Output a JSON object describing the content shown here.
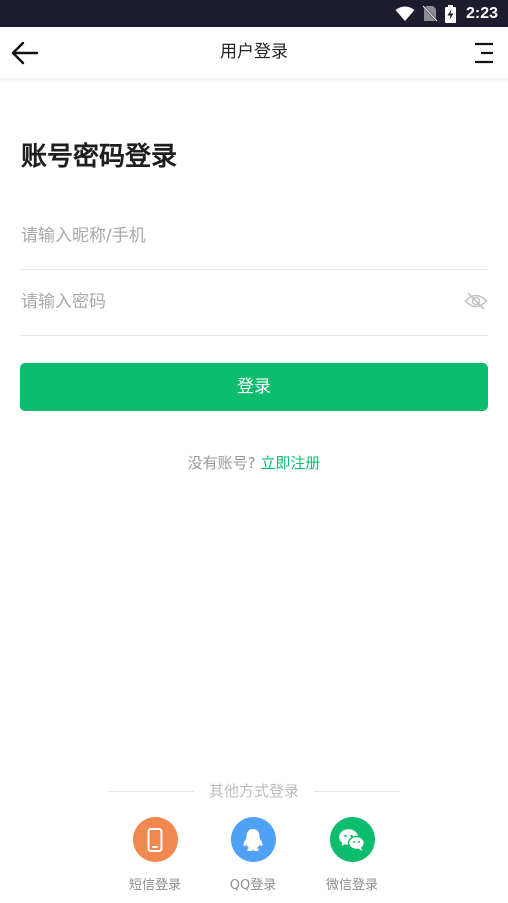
{
  "status_bar": {
    "time": "2:23"
  },
  "header": {
    "title": "用户登录"
  },
  "login": {
    "title": "账号密码登录",
    "username_placeholder": "请输入昵称/手机",
    "password_placeholder": "请输入密码",
    "submit_label": "登录",
    "register_prompt": "没有账号?",
    "register_link": "立即注册"
  },
  "other_login": {
    "label": "其他方式登录",
    "methods": [
      {
        "label": "短信登录",
        "icon": "phone-icon",
        "color": "#f0884f"
      },
      {
        "label": "QQ登录",
        "icon": "qq-icon",
        "color": "#4ea1f4"
      },
      {
        "label": "微信登录",
        "icon": "wechat-icon",
        "color": "#0dbd6e"
      }
    ]
  },
  "colors": {
    "accent": "#0dbd6e",
    "status_bar": "#1c1c2e"
  }
}
